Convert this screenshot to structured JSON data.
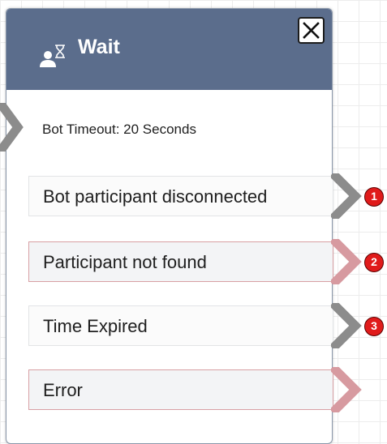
{
  "block": {
    "title": "Wait",
    "icon": "person-hourglass-icon",
    "close_icon": "close-icon",
    "timeout_text": "Bot Timeout: 20 Seconds"
  },
  "branches": [
    {
      "label": "Bot participant disconnected",
      "badge": "1",
      "connected": true
    },
    {
      "label": "Participant not found",
      "badge": "2",
      "connected": false
    },
    {
      "label": "Time Expired",
      "badge": "3",
      "connected": true
    },
    {
      "label": "Error",
      "badge": "",
      "connected": false
    }
  ],
  "colors": {
    "header": "#5b6d8c",
    "connected_arrow": "#8c8c8c",
    "unconnected_arrow": "#d79aa0",
    "badge": "#e01b1b"
  }
}
